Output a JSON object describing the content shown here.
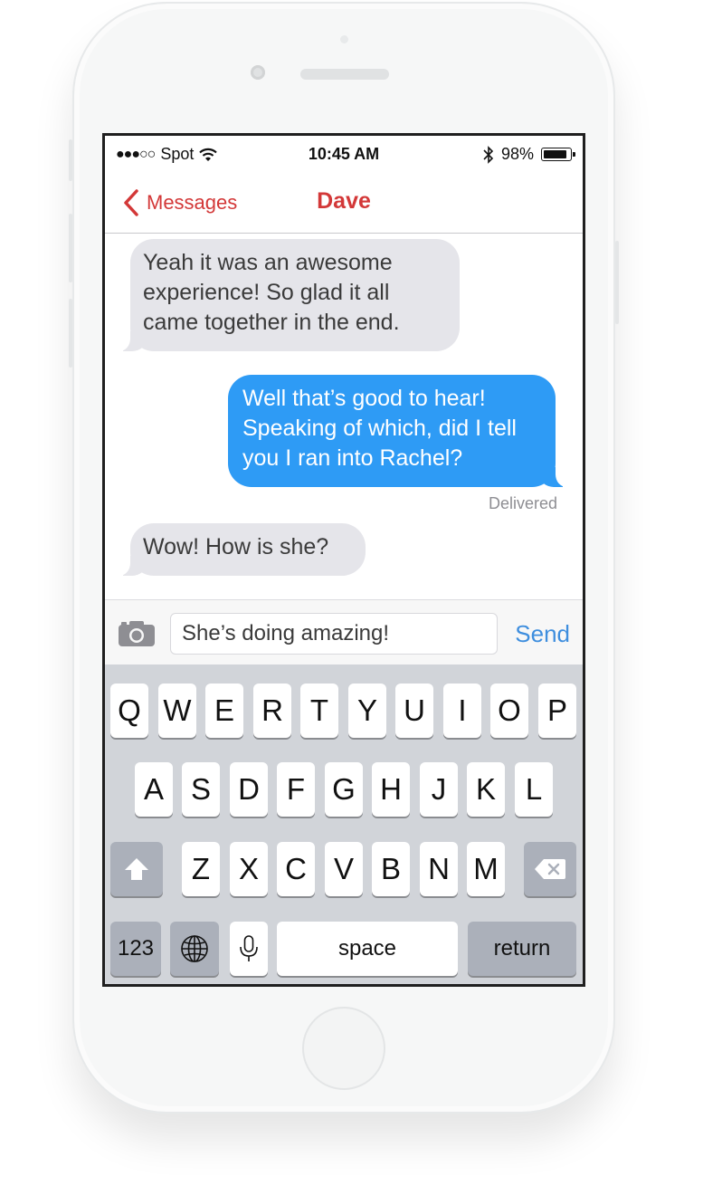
{
  "status_bar": {
    "signal": "●●●○○",
    "carrier": "Spot",
    "time": "10:45 AM",
    "battery_percent": "98%",
    "battery_level": 0.98
  },
  "nav": {
    "back_label": "Messages",
    "title": "Dave"
  },
  "messages": [
    {
      "direction": "incoming",
      "text": "Yeah it was an awesome experience! So glad it all came together in the end."
    },
    {
      "direction": "outgoing",
      "text": "Well that’s good to hear! Speaking of which, did I tell you I ran into Rachel?"
    },
    {
      "direction": "incoming",
      "text": "Wow! How is she?"
    }
  ],
  "delivered_label": "Delivered",
  "compose": {
    "input_value": "She’s doing amazing!",
    "send_label": "Send"
  },
  "keyboard": {
    "row1": [
      "Q",
      "W",
      "E",
      "R",
      "T",
      "Y",
      "U",
      "I",
      "O",
      "P"
    ],
    "row2": [
      "A",
      "S",
      "D",
      "F",
      "G",
      "H",
      "J",
      "K",
      "L"
    ],
    "row3": [
      "Z",
      "X",
      "C",
      "V",
      "B",
      "N",
      "M"
    ],
    "numbers_label": "123",
    "space_label": "space",
    "return_label": "return"
  },
  "icons": [
    "back-chevron-icon",
    "wifi-icon",
    "bluetooth-icon",
    "battery-icon",
    "camera-icon",
    "shift-icon",
    "backspace-icon",
    "globe-icon",
    "microphone-icon"
  ],
  "colors": {
    "accent_red": "#d33838",
    "bubble_blue": "#2e9bf5",
    "bubble_gray": "#e5e5ea",
    "send_blue": "#3e8ede",
    "keyboard_bg": "#d1d4d9"
  }
}
